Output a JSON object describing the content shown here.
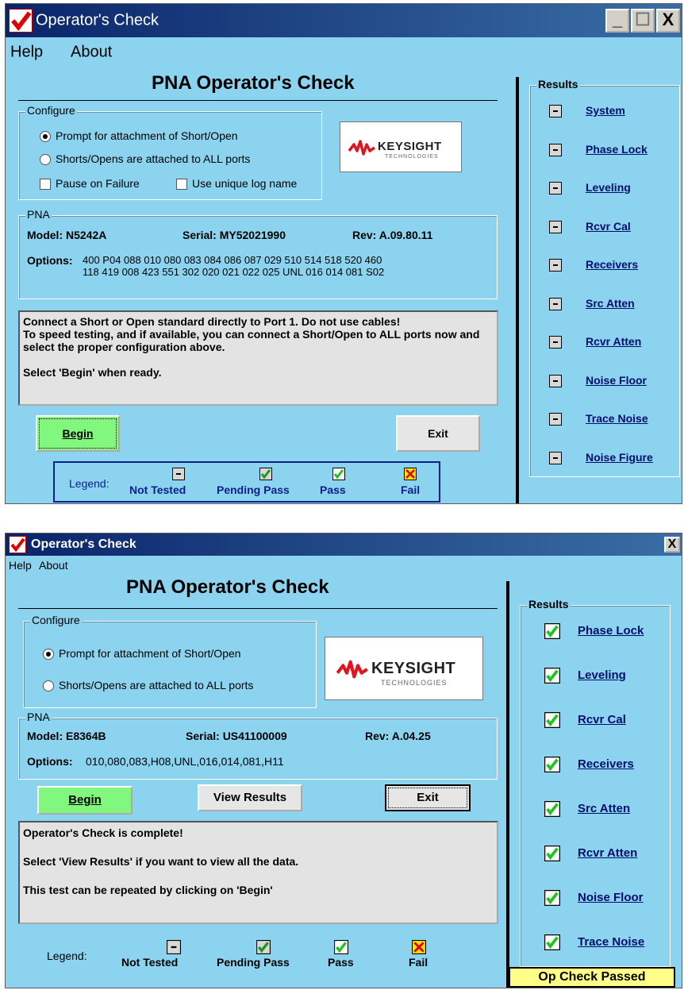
{
  "window1": {
    "title": "Operator's Check",
    "titlebar_buttons": [
      "_",
      "☐",
      "X"
    ],
    "menu": [
      "Help",
      "About"
    ],
    "heading": "PNA Operator's Check",
    "configure": {
      "group_label": "Configure",
      "radio1": "Prompt for attachment of Short/Open",
      "radio2": "Shorts/Opens are attached to ALL ports",
      "check1": "Pause on Failure",
      "check2": "Use unique log name"
    },
    "pna": {
      "group_label": "PNA",
      "model": "Model: N5242A",
      "serial": "Serial: MY52021990",
      "rev": "Rev:  A.09.80.11",
      "options_label": "Options:",
      "options_line1": "400 P04 088 010 080 083 084 086 087 029 510 514 518 520 460",
      "options_line2": "118 419 008 423 551 302 020 021 022 025 UNL 016 014 081 S02"
    },
    "logo": {
      "name": "KEYSIGHT",
      "sub": "TECHNOLOGIES"
    },
    "message": "Connect a Short or Open standard directly to Port 1. Do not use cables!\nTo speed testing, and if available, you can connect a Short/Open to ALL ports now and select the proper configuration above.\n\nSelect 'Begin' when ready.",
    "begin_label": "Begin",
    "exit_label": "Exit",
    "legend": {
      "title": "Legend:",
      "items": [
        "Not Tested",
        "Pending Pass",
        "Pass",
        "Fail"
      ]
    },
    "results_label": "Results",
    "results": [
      {
        "label": "System",
        "status": "not-tested"
      },
      {
        "label": "Phase Lock",
        "status": "not-tested"
      },
      {
        "label": "Leveling",
        "status": "not-tested"
      },
      {
        "label": "Rcvr Cal",
        "status": "not-tested"
      },
      {
        "label": "Receivers",
        "status": "not-tested"
      },
      {
        "label": "Src Atten",
        "status": "not-tested"
      },
      {
        "label": "Rcvr Atten",
        "status": "not-tested"
      },
      {
        "label": "Noise Floor",
        "status": "not-tested"
      },
      {
        "label": "Trace Noise",
        "status": "not-tested"
      },
      {
        "label": "Noise Figure",
        "status": "not-tested"
      }
    ]
  },
  "window2": {
    "title": "Operator's Check",
    "titlebar_buttons": [
      "X"
    ],
    "menu": [
      "Help",
      "About"
    ],
    "heading": "PNA Operator's Check",
    "configure": {
      "group_label": "Configure",
      "radio1": "Prompt for attachment of Short/Open",
      "radio2": "Shorts/Opens are attached to ALL ports"
    },
    "pna": {
      "group_label": "PNA",
      "model": "Model: E8364B",
      "serial": "Serial: US41100009",
      "rev": "Rev: A.04.25",
      "options_label": "Options:",
      "options_line1": "010,080,083,H08,UNL,016,014,081,H11"
    },
    "logo": {
      "name": "KEYSIGHT",
      "sub": "TECHNOLOGIES"
    },
    "begin_label": "Begin",
    "view_results_label": "View Results",
    "exit_label": "Exit",
    "message": "Operator's Check is complete!\n\nSelect 'View Results' if you want to view all the data.\n\nThis test can be repeated by clicking on 'Begin'",
    "legend": {
      "title": "Legend:",
      "items": [
        "Not Tested",
        "Pending Pass",
        "Pass",
        "Fail"
      ]
    },
    "results_label": "Results",
    "results": [
      {
        "label": "Phase Lock",
        "status": "pass"
      },
      {
        "label": "Leveling",
        "status": "pass"
      },
      {
        "label": "Rcvr Cal",
        "status": "pass"
      },
      {
        "label": "Receivers",
        "status": "pass"
      },
      {
        "label": "Src Atten",
        "status": "pass"
      },
      {
        "label": "Rcvr Atten",
        "status": "pass"
      },
      {
        "label": "Noise Floor",
        "status": "pass"
      },
      {
        "label": "Trace Noise",
        "status": "pass"
      }
    ],
    "passed_banner": "Op Check Passed"
  },
  "colors": {
    "window_bg": "#8cd3ef",
    "title_bar": "#0a246a",
    "begin_green": "#82f77e",
    "legend_blue": "#0b1f8a",
    "banner_yellow": "#ffff88"
  }
}
